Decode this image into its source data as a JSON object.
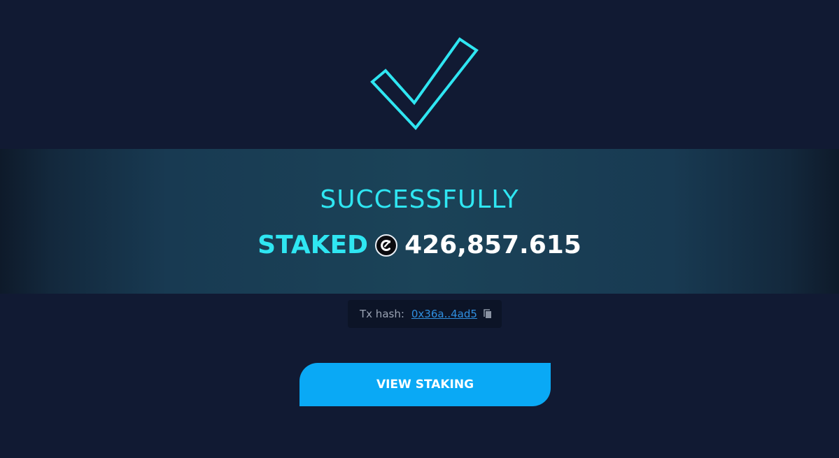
{
  "result": {
    "title": "SUCCESSFULLY",
    "action": "STAKED",
    "token_icon": "token-c-icon",
    "amount": "426,857.615"
  },
  "transaction": {
    "label": "Tx hash:",
    "hash_short": "0x36a..4ad5",
    "copy_icon": "copy-icon"
  },
  "actions": {
    "view_staking_label": "VIEW STAKING"
  },
  "icons": {
    "checkmark": "checkmark-icon"
  },
  "colors": {
    "background": "#111a33",
    "accent_cyan": "#2fe6f2",
    "button_blue": "#0aa9f5",
    "link_blue": "#2f8fe0"
  }
}
